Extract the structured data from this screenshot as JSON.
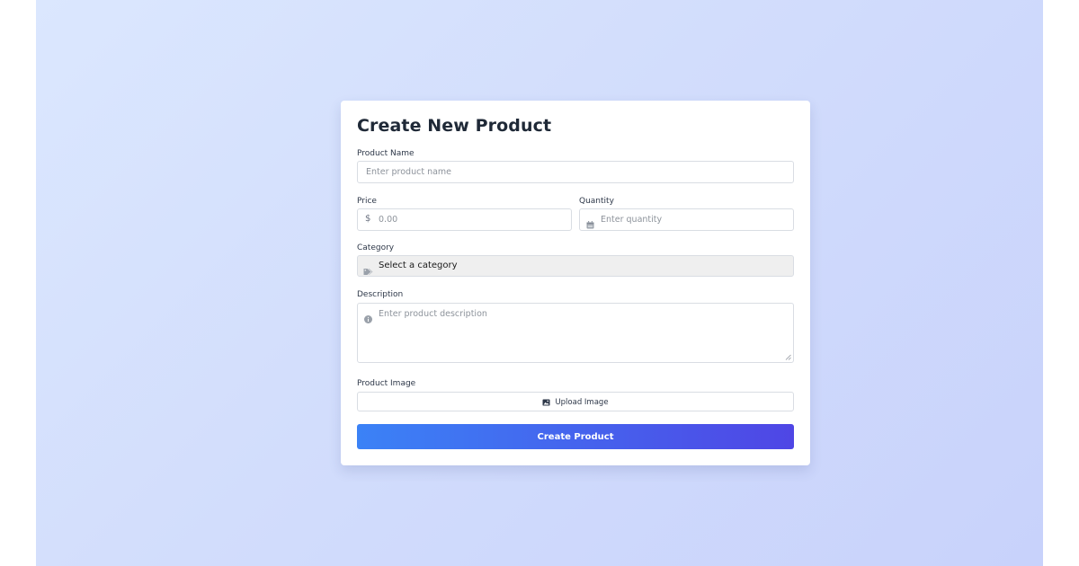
{
  "form": {
    "title": "Create New Product",
    "product_name": {
      "label": "Product Name",
      "placeholder": "Enter product name",
      "value": ""
    },
    "price": {
      "label": "Price",
      "prefix": "$",
      "placeholder": "0.00",
      "value": ""
    },
    "quantity": {
      "label": "Quantity",
      "icon": "calendar-icon",
      "placeholder": "Enter quantity",
      "value": ""
    },
    "category": {
      "label": "Category",
      "icon": "tag-icon",
      "selected": "Select a category"
    },
    "description": {
      "label": "Description",
      "icon": "info-icon",
      "placeholder": "Enter product description",
      "value": ""
    },
    "product_image": {
      "label": "Product Image",
      "icon": "image-icon",
      "upload_label": "Upload Image"
    },
    "submit_label": "Create Product"
  },
  "colors": {
    "background_start": "#dbe7fe",
    "background_end": "#c8d2fb",
    "button_start": "#3b82f6",
    "button_end": "#4f46e5",
    "title": "#1f2937"
  }
}
